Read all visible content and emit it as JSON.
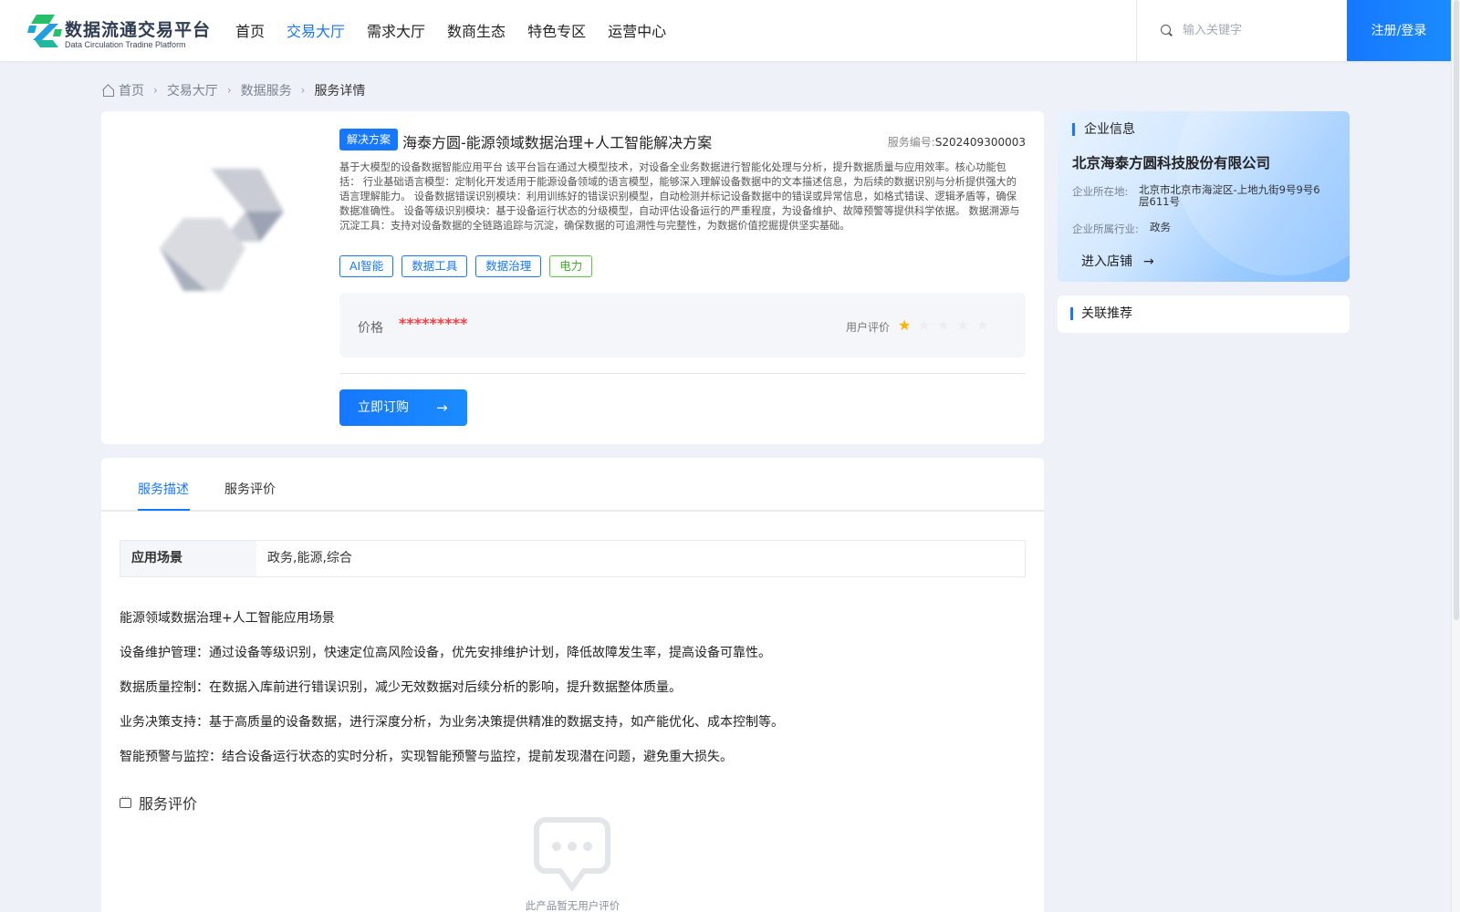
{
  "header": {
    "logo_title": "数据流通交易平台",
    "logo_subtitle": "Data Circulation Tradine Platform",
    "nav": [
      "首页",
      "交易大厅",
      "需求大厅",
      "数商生态",
      "特色专区",
      "运营中心"
    ],
    "active_nav": "交易大厅",
    "search_placeholder": "输入关键字",
    "login_label": "注册/登录"
  },
  "breadcrumb": {
    "items": [
      "首页",
      "交易大厅",
      "数据服务"
    ],
    "current": "服务详情"
  },
  "product": {
    "type_tag": "解决方案",
    "title": "海泰方圆-能源领域数据治理+人工智能解决方案",
    "service_no_label": "服务编号:",
    "service_no": "S202409300003",
    "description": "基于大模型的设备数据智能应用平台 该平台旨在通过大模型技术，对设备全业务数据进行智能化处理与分析，提升数据质量与应用效率。核心功能包括： 行业基础语言模型：定制化开发适用于能源设备领域的语言模型，能够深入理解设备数据中的文本描述信息，为后续的数据识别与分析提供强大的语言理解能力。 设备数据错误识别模块：利用训练好的错误识别模型，自动检测并标记设备数据中的错误或异常信息，如格式错误、逻辑矛盾等，确保数据准确性。 设备等级识别模块：基于设备运行状态的分级模型，自动评估设备运行的严重程度，为设备维护、故障预警等提供科学依据。 数据溯源与沉淀工具：支持对设备数据的全链路追踪与沉淀，确保数据的可追溯性与完整性，为数据价值挖掘提供坚实基础。",
    "tags": [
      "AI智能",
      "数据工具",
      "数据治理",
      "电力"
    ],
    "price_label": "价格",
    "price_value": "*********",
    "rating_label": "用户评价",
    "rating": 1,
    "rating_max": 5,
    "buy_label": "立即订购",
    "colors": {
      "accent": "#1677ff",
      "price": "#ff3b3b",
      "tag_green": "#3fae26",
      "star": "#ffb300"
    }
  },
  "enterprise": {
    "heading": "企业信息",
    "name": "北京海泰方圆科技股份有限公司",
    "location_label": "企业所在地:",
    "location": "北京市北京市海淀区-上地九街9号9号6层611号",
    "industry_label": "企业所属行业:",
    "industry": "政务",
    "enter_store": "进入店铺"
  },
  "related": {
    "heading": "关联推荐"
  },
  "detail": {
    "tabs": [
      "服务描述",
      "服务评价"
    ],
    "active_tab": "服务描述",
    "scene_label": "应用场景",
    "scene_value": "政务,能源,综合",
    "paragraphs": [
      "能源领域数据治理+人工智能应用场景",
      "设备维护管理：通过设备等级识别，快速定位高风险设备，优先安排维护计划，降低故障发生率，提高设备可靠性。",
      "数据质量控制：在数据入库前进行错误识别，减少无效数据对后续分析的影响，提升数据整体质量。",
      "业务决策支持：基于高质量的设备数据，进行深度分析，为业务决策提供精准的数据支持，如产能优化、成本控制等。",
      "智能预警与监控：结合设备运行状态的实时分析，实现智能预警与监控，提前发现潜在问题，避免重大损失。"
    ],
    "review_heading": "服务评价",
    "empty_text": "此产品暂无用户评价"
  }
}
